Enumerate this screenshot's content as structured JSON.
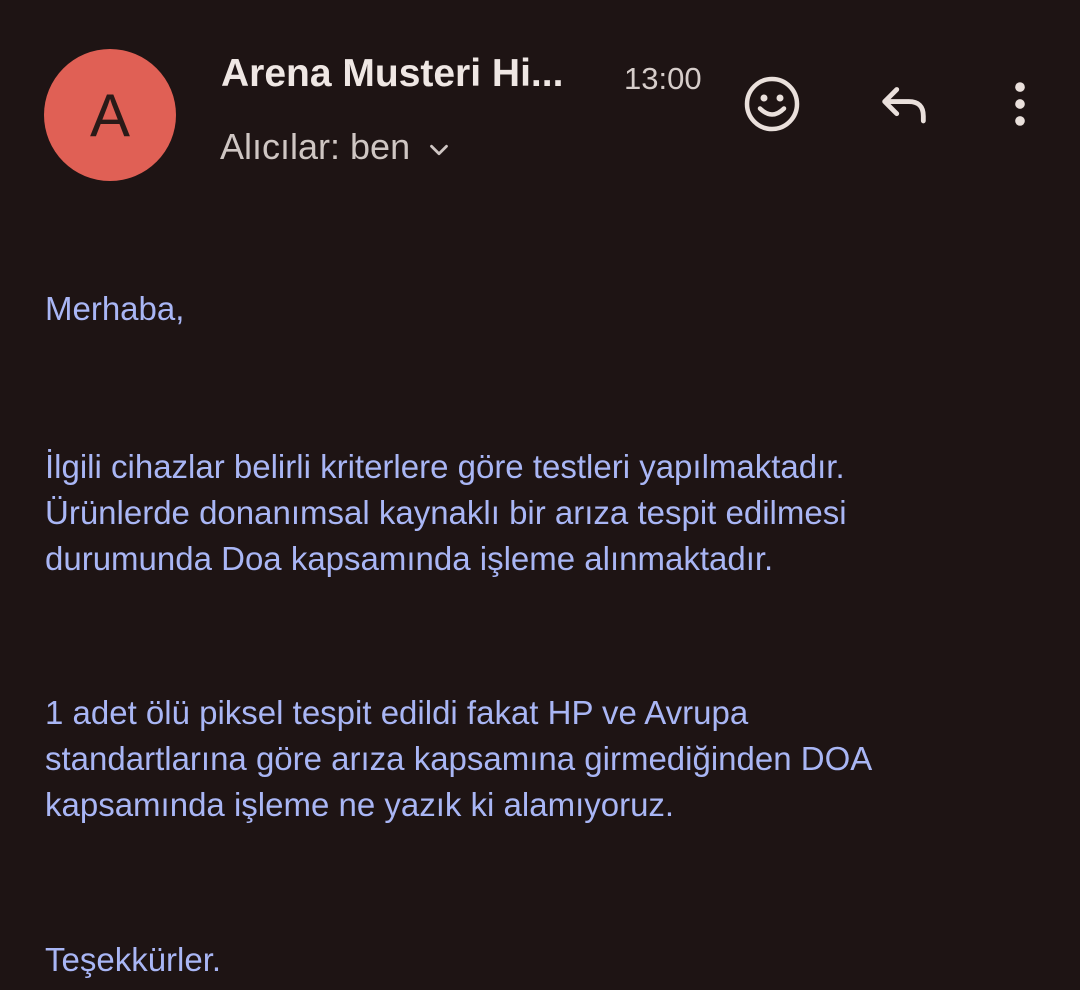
{
  "header": {
    "avatar_letter": "A",
    "avatar_color": "#e06055",
    "sender_name": "Arena Musteri Hi...",
    "time": "13:00",
    "recipients_label": "Alıcılar: ben"
  },
  "icons": {
    "emoji": "smiley-face-icon",
    "reply": "reply-arrow-icon",
    "more": "more-vertical-icon",
    "expand": "chevron-down-icon"
  },
  "message": {
    "greeting": "Merhaba,",
    "paragraph1_line1": "İlgili cihazlar belirli kriterlere göre testleri yapılmaktadır.",
    "paragraph1_line2": "Ürünlerde donanımsal kaynaklı bir arıza tespit edilmesi",
    "paragraph1_line3": "durumunda Doa kapsamında işleme alınmaktadır.",
    "paragraph2_line1": "1 adet ölü piksel tespit edildi fakat HP ve Avrupa",
    "paragraph2_line2": "standartlarına göre arıza kapsamına girmediğinden DOA",
    "paragraph2_line3": "kapsamında işleme ne yazık ki alamıyoruz.",
    "closing": "Teşekkürler."
  },
  "colors": {
    "background": "#1e1414",
    "body_text": "#a9b6f5",
    "icon": "#eae0dc"
  }
}
